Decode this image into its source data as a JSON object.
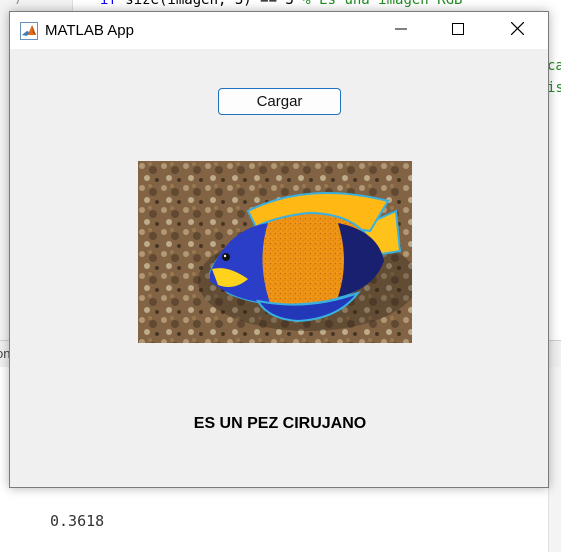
{
  "editor": {
    "line_number": "7",
    "code_keyword": "if",
    "code_body": " size(imagen, 3) == 3 ",
    "code_comment": "% Es una imagen RGB",
    "right_fragment_1": "ca",
    "right_fragment_2": "is"
  },
  "divider": {
    "left_fragment": "on"
  },
  "command_window": {
    "output": "0.3618"
  },
  "app": {
    "title": "MATLAB App",
    "load_button_label": "Cargar",
    "result_label": "ES UN PEZ CIRUJANO",
    "image_description_icon": "fish-photo"
  },
  "colors": {
    "button_border": "#1e73be",
    "window_bg": "#f0f0f0",
    "titlebar_bg": "#ffffff",
    "comment_green": "#228b22",
    "keyword_blue": "#0e00ff"
  }
}
